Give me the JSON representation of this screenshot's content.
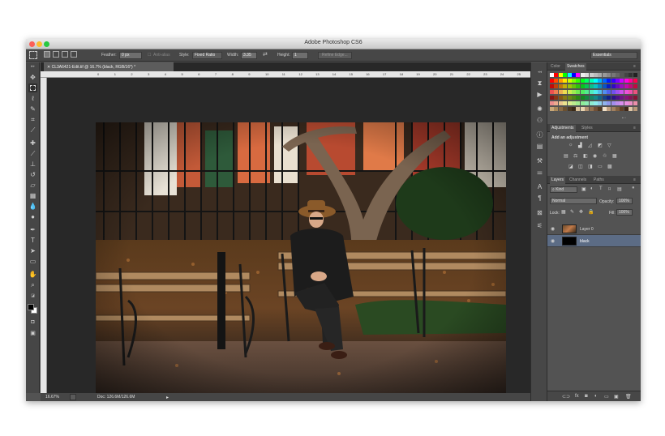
{
  "window": {
    "title": "Adobe Photoshop CS6"
  },
  "options_bar": {
    "feather_label": "Feather:",
    "feather_value": "0 px",
    "anti_alias_label": "Anti-alias",
    "style_label": "Style:",
    "style_value": "Fixed Ratio",
    "width_label": "Width:",
    "width_value": "3.35",
    "height_label": "Height:",
    "height_value": "1",
    "refine_edge_label": "Refine Edge...",
    "workspace_value": "Essentials"
  },
  "document": {
    "tab_label": "CL3A6421-Edit.tif @ 16.7% (black, RGB/16*) *",
    "ruler_ticks": [
      "0",
      "1",
      "2",
      "3",
      "4",
      "5",
      "6",
      "7",
      "8",
      "9",
      "10",
      "11",
      "12",
      "13",
      "14",
      "15",
      "16",
      "17",
      "18",
      "19",
      "20",
      "21",
      "22",
      "23",
      "24",
      "25"
    ]
  },
  "status_bar": {
    "zoom": "16.67%",
    "doc_size": "Doc: 126.6M/126.6M"
  },
  "panels": {
    "color_tab": "Color",
    "swatches_tab": "Swatches",
    "adjustments_tab": "Adjustments",
    "styles_tab": "Styles",
    "add_adjustment_label": "Add an adjustment",
    "layers_tab": "Layers",
    "channels_tab": "Channels",
    "paths_tab": "Paths",
    "kind_filter": "Kind",
    "blend_mode": "Normal",
    "opacity_label": "Opacity:",
    "opacity_value": "100%",
    "lock_label": "Lock:",
    "fill_label": "Fill:",
    "fill_value": "100%",
    "layers": [
      {
        "name": "Layer 0"
      },
      {
        "name": "black"
      }
    ]
  },
  "colors": {
    "accent_selected_layer": "#5c6c85",
    "foreground_color": "#000000",
    "background_color": "#ffffff"
  },
  "icons": {
    "tools": [
      "move-icon",
      "marquee-icon",
      "lasso-icon",
      "quick-select-icon",
      "crop-icon",
      "eyedropper-icon",
      "healing-icon",
      "brush-icon",
      "stamp-icon",
      "history-brush-icon",
      "eraser-icon",
      "gradient-icon",
      "blur-icon",
      "dodge-icon",
      "pen-icon",
      "type-icon",
      "path-select-icon",
      "shape-icon",
      "hand-icon",
      "zoom-icon"
    ]
  }
}
